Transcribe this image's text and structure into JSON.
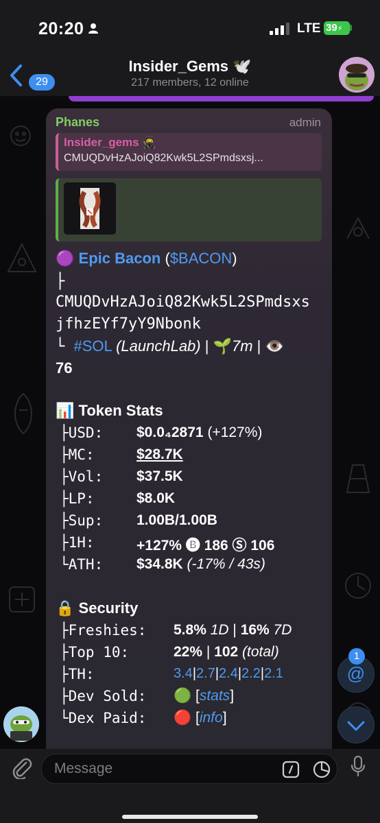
{
  "status": {
    "time": "20:20",
    "network": "LTE",
    "battery": "39"
  },
  "header": {
    "back_count": "29",
    "title": "Insider_Gems 🕊️",
    "subtitle": "217 members, 12 online"
  },
  "message": {
    "sender": "Phanes",
    "role": "admin",
    "reply": {
      "name": "Insider_gems 🥷",
      "text": "CMUQDvHzAJoiQ82Kwk5L2SPmdsxsj..."
    },
    "token": {
      "emoji": "🟣",
      "name": "Epic Bacon",
      "ticker_open": " (",
      "ticker": "$BACON",
      "ticker_close": ")",
      "tree_branch": "├",
      "address_1": "CMUQDvHzAJoiQ82Kwk5L2SPmdsxs",
      "address_2": "jfhzEYf7yY9Nbonk",
      "chain_prefix": "└ ",
      "chain": "#SOL",
      "launchpad": "(LaunchLab)",
      "sep": " | ",
      "age_emoji": "🌱",
      "age": "7m",
      "views_emoji": "👁️",
      "views": "76"
    },
    "token_stats": {
      "heading_emoji": "📊",
      "heading": "Token Stats",
      "rows": [
        {
          "key": "├USD:",
          "value": "$0.0₄2871",
          "extra": " (+127%)"
        },
        {
          "key": "├MC:",
          "value": "$28.7K",
          "extra": ""
        },
        {
          "key": "├Vol:",
          "value": "$37.5K",
          "extra": ""
        },
        {
          "key": "├LP:",
          "value": "$8.0K",
          "extra": ""
        },
        {
          "key": "├Sup:",
          "value": "1.00B/1.00B",
          "extra": ""
        },
        {
          "key": "├1H:",
          "value": "+127% 🅑 186 Ⓢ 106",
          "extra": ""
        },
        {
          "key": "└ATH:",
          "value": "$34.8K",
          "extra": " (-17% / 43s)"
        }
      ]
    },
    "security": {
      "heading_emoji": "🔒",
      "heading": "Security",
      "freshies": {
        "key": "├Freshies:",
        "v1": "5.8%",
        "p1": " 1D",
        "mid": " | ",
        "v2": "16%",
        "p2": " 7D"
      },
      "top10": {
        "key": "├Top 10:",
        "v1": "22%",
        "mid": " | ",
        "v2": "102",
        "p2": " (total)"
      },
      "th": {
        "key": "├TH:",
        "values": [
          "3.4",
          "2.7",
          "2.4",
          "2.2",
          "2.1"
        ],
        "divider": "|"
      },
      "dev_sold": {
        "key": "├Dev Sold:",
        "emoji": "🟢",
        "open": " [",
        "link": "stats",
        "close": "]"
      },
      "dex_paid": {
        "key": "└Dex Paid:",
        "emoji": "🔴",
        "open": " [",
        "link": "info",
        "close": "]"
      }
    }
  },
  "mentions_badge": "1",
  "mention_symbol": "@",
  "input": {
    "placeholder": "Message"
  },
  "colors": {
    "accent": "#3e8ef0",
    "sender": "#7fcf64",
    "reply_name": "#d85ea8",
    "link": "#4f9bf0",
    "battery": "#3bc54a"
  }
}
